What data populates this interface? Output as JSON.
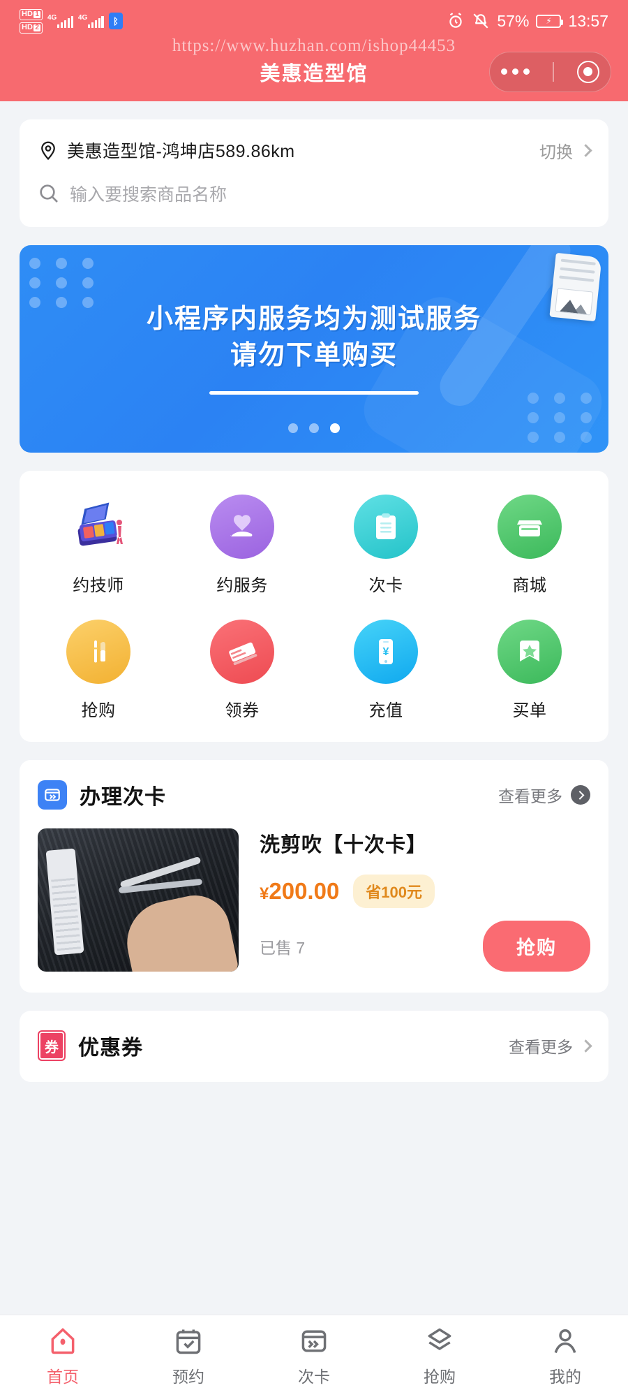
{
  "statusbar": {
    "hd1_label": "HD",
    "hd1_num": "1",
    "hd2_label": "HD",
    "hd2_num": "2",
    "net1": "4G",
    "net2": "4G",
    "bluetooth_icon": "bluetooth-icon",
    "alarm_icon": "alarm-icon",
    "mute_icon": "bell-muted-icon",
    "battery_percent": "57%",
    "battery_icon": "battery-charging-icon",
    "time": "13:57"
  },
  "watermark": "https://www.huzhan.com/ishop44453",
  "header": {
    "title": "美惠造型馆",
    "brand_color": "#f76a6f",
    "capsule": {
      "menu_icon": "more-dots-icon",
      "target_icon": "target-circle-icon"
    }
  },
  "location": {
    "pin_icon": "location-pin-icon",
    "text": "美惠造型馆-鸿坤店589.86km",
    "switch_label": "切换",
    "chevron_icon": "chevron-right-icon"
  },
  "search": {
    "icon": "search-icon",
    "placeholder": "输入要搜索商品名称",
    "value": ""
  },
  "banner": {
    "line1": "小程序内服务均为测试服务",
    "line2": "请勿下单购买",
    "bg_color": "#2b82f3",
    "pager": {
      "total": 3,
      "active_index": 3
    }
  },
  "grid": {
    "row1": [
      {
        "label": "约技师",
        "icon": "technician-device-icon",
        "color": "#4a3fb0"
      },
      {
        "label": "约服务",
        "icon": "heart-in-hand-icon",
        "color": "#a470e8"
      },
      {
        "label": "次卡",
        "icon": "clipboard-icon",
        "color": "#34cfd8"
      },
      {
        "label": "商城",
        "icon": "shop-store-icon",
        "color": "#4cc76a"
      }
    ],
    "row2": [
      {
        "label": "抢购",
        "icon": "cosmetics-brush-icon",
        "color": "#f7bf45"
      },
      {
        "label": "领券",
        "icon": "ticket-icon",
        "color": "#f4585f"
      },
      {
        "label": "充值",
        "icon": "phone-yuan-icon",
        "color": "#17b9f3"
      },
      {
        "label": "买单",
        "icon": "star-badge-icon",
        "color": "#4cc76a"
      }
    ]
  },
  "pass_card_section": {
    "icon": "pass-card-icon",
    "title": "办理次卡",
    "more_label": "查看更多",
    "more_icon": "arrow-circle-right-icon",
    "product": {
      "image_alt": "haircut-scissors-photo",
      "name": "洗剪吹【十次卡】",
      "currency": "¥",
      "price": "200.00",
      "save_badge": "省100元",
      "sold_label": "已售 7",
      "buy_label": "抢购",
      "price_color": "#f07a18",
      "buy_color": "#fa6b72"
    }
  },
  "coupon_section": {
    "icon": "coupon-badge-icon",
    "icon_text": "券",
    "title": "优惠券",
    "more_label": "查看更多",
    "more_icon": "chevron-right-icon"
  },
  "tabbar": {
    "active_color": "#f4606c",
    "inactive_color": "#6e7074",
    "items": [
      {
        "label": "首页",
        "icon": "home-icon",
        "active": true
      },
      {
        "label": "预约",
        "icon": "calendar-icon",
        "active": false
      },
      {
        "label": "次卡",
        "icon": "pass-card-icon",
        "active": false
      },
      {
        "label": "抢购",
        "icon": "layers-icon",
        "active": false
      },
      {
        "label": "我的",
        "icon": "person-icon",
        "active": false
      }
    ]
  }
}
